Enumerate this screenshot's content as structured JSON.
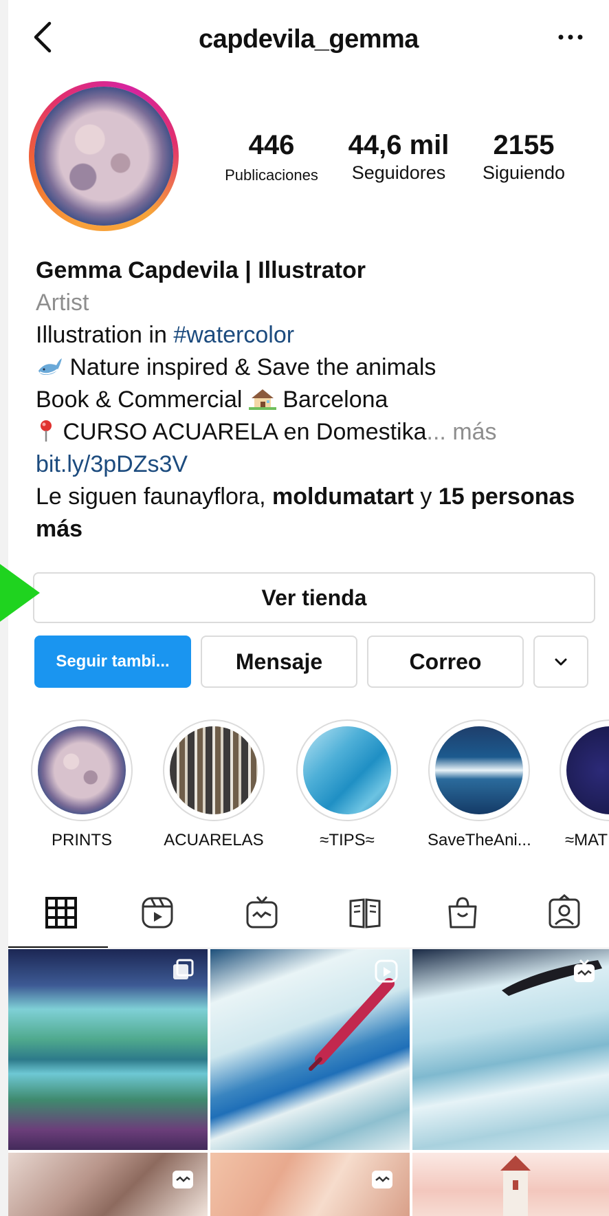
{
  "header": {
    "username": "capdevila_gemma"
  },
  "stats": [
    {
      "value": "446",
      "label": "Publicaciones"
    },
    {
      "value": "44,6 mil",
      "label": "Seguidores"
    },
    {
      "value": "2155",
      "label": "Siguiendo"
    }
  ],
  "bio": {
    "name": "Gemma Capdevila | Illustrator",
    "category": "Artist",
    "line1_prefix": "Illustration in ",
    "line1_hashtag": "#watercolor",
    "line2": " Nature inspired & Save the animals",
    "line3_prefix": "Book & Commercial ",
    "line3_suffix": " Barcelona",
    "line4": " CURSO ACUARELA en Domestika",
    "more": "... más",
    "link": "bit.ly/3pDZs3V",
    "followed_prefix": "Le siguen faunayflora, ",
    "followed_user2": "moldumatart",
    "followed_mid": " y ",
    "followed_count": "15 personas más"
  },
  "buttons": {
    "shop": "Ver tienda",
    "follow": "Seguir tambi...",
    "message": "Mensaje",
    "email": "Correo"
  },
  "highlights": [
    {
      "label": "PRINTS"
    },
    {
      "label": "ACUARELAS"
    },
    {
      "label": "≈TIPS≈"
    },
    {
      "label": "SaveTheAni..."
    },
    {
      "label": "≈MAT"
    }
  ],
  "tabs": [
    "grid-icon",
    "reels-icon",
    "igtv-icon",
    "guides-icon",
    "shop-icon",
    "tagged-icon"
  ],
  "colors": {
    "primary_button": "#1a95f0",
    "link": "#1c4b7e",
    "muted": "#8e8e8e",
    "annotation_arrow": "#1fd31f"
  }
}
